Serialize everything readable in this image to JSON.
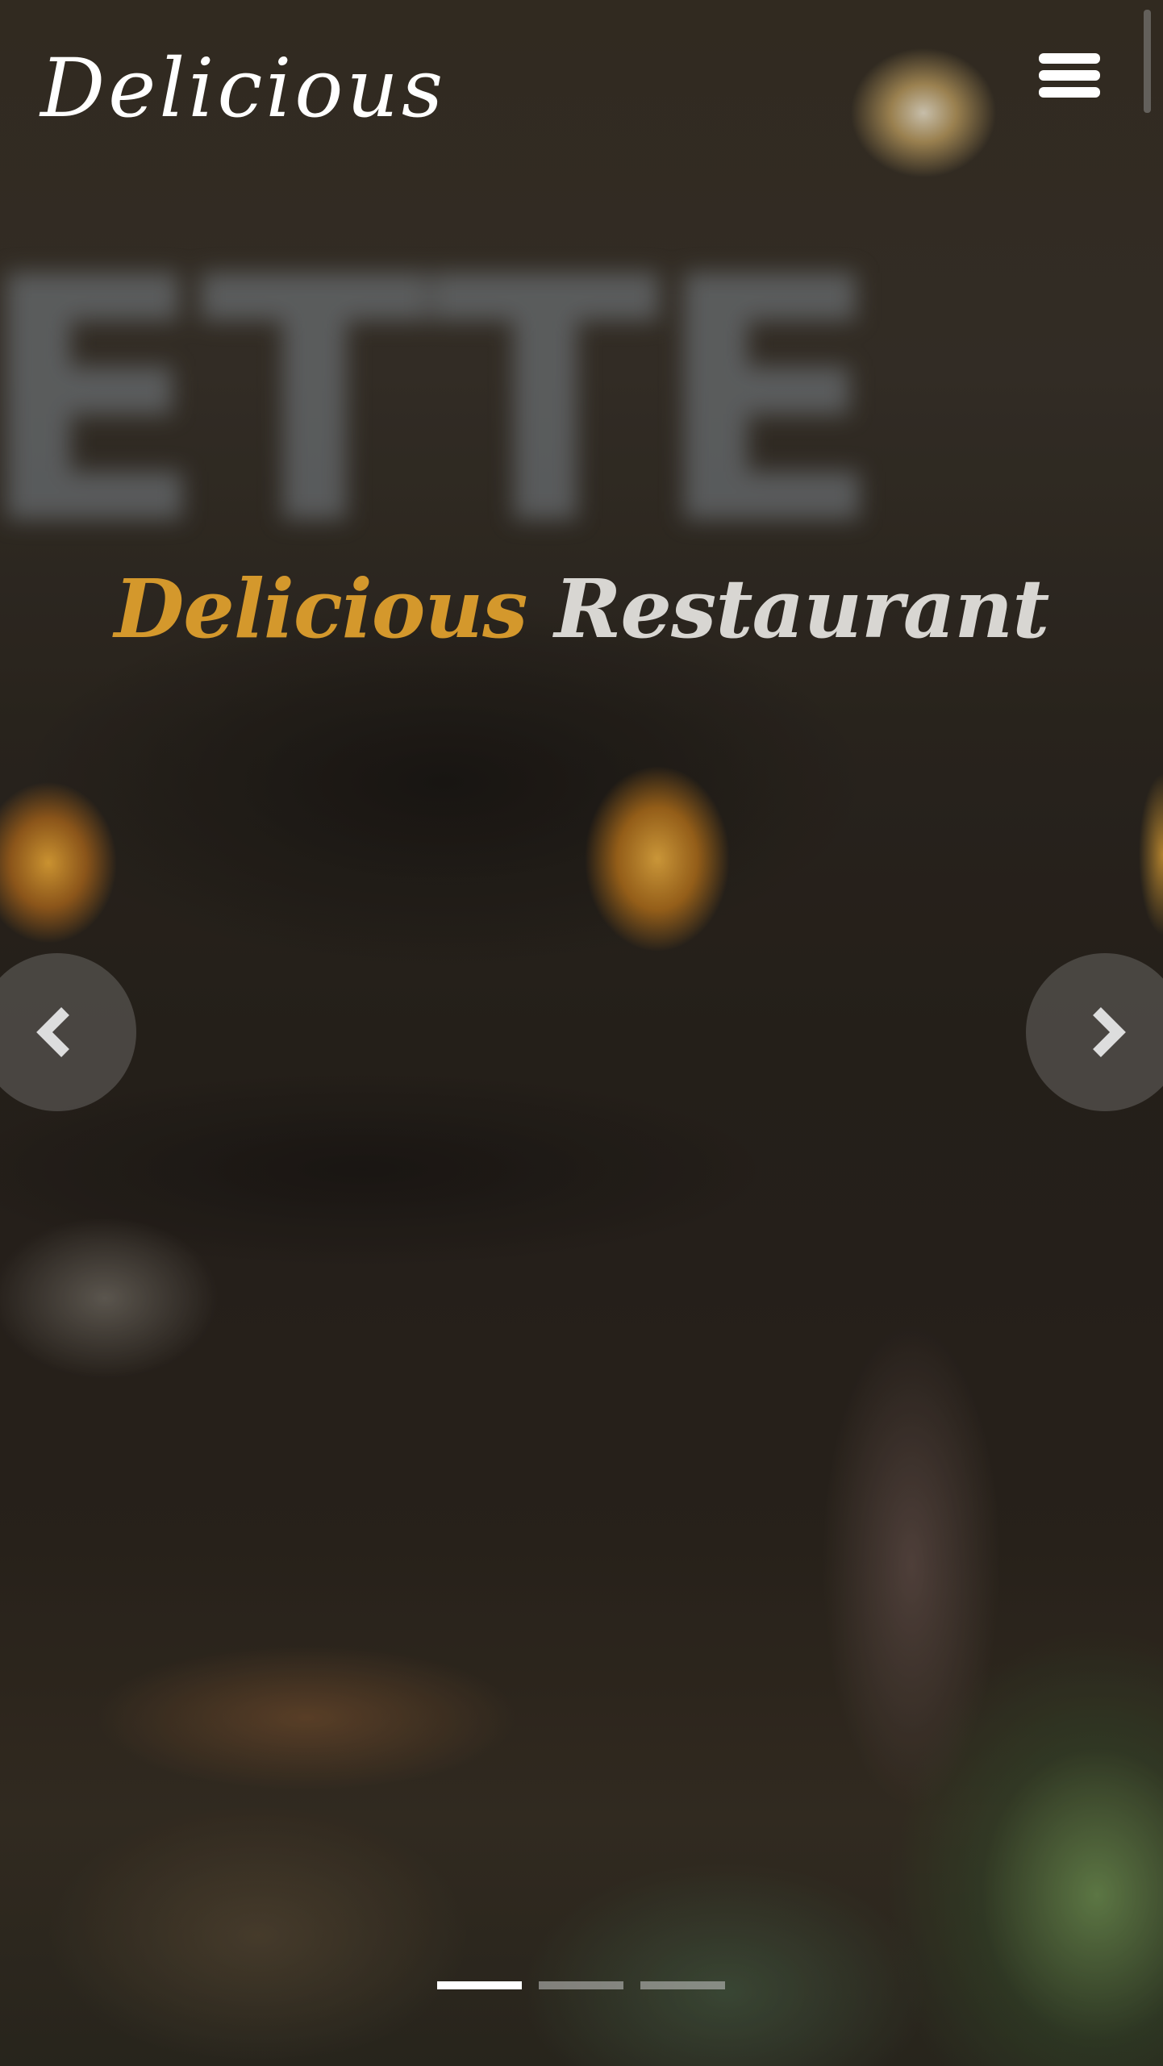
{
  "navbar": {
    "brand": "Delicious",
    "menu_icon": "hamburger-menu-icon"
  },
  "hero": {
    "title_highlight": "Delicious",
    "title_rest": "Restaurant",
    "background_text": "ETTE",
    "prev_icon": "chevron-left-icon",
    "next_icon": "chevron-right-icon",
    "slide_count": 3,
    "active_slide": 1
  },
  "colors": {
    "accent": "#d4982c",
    "title_secondary": "#d8d6d2",
    "text": "#ffffff"
  }
}
